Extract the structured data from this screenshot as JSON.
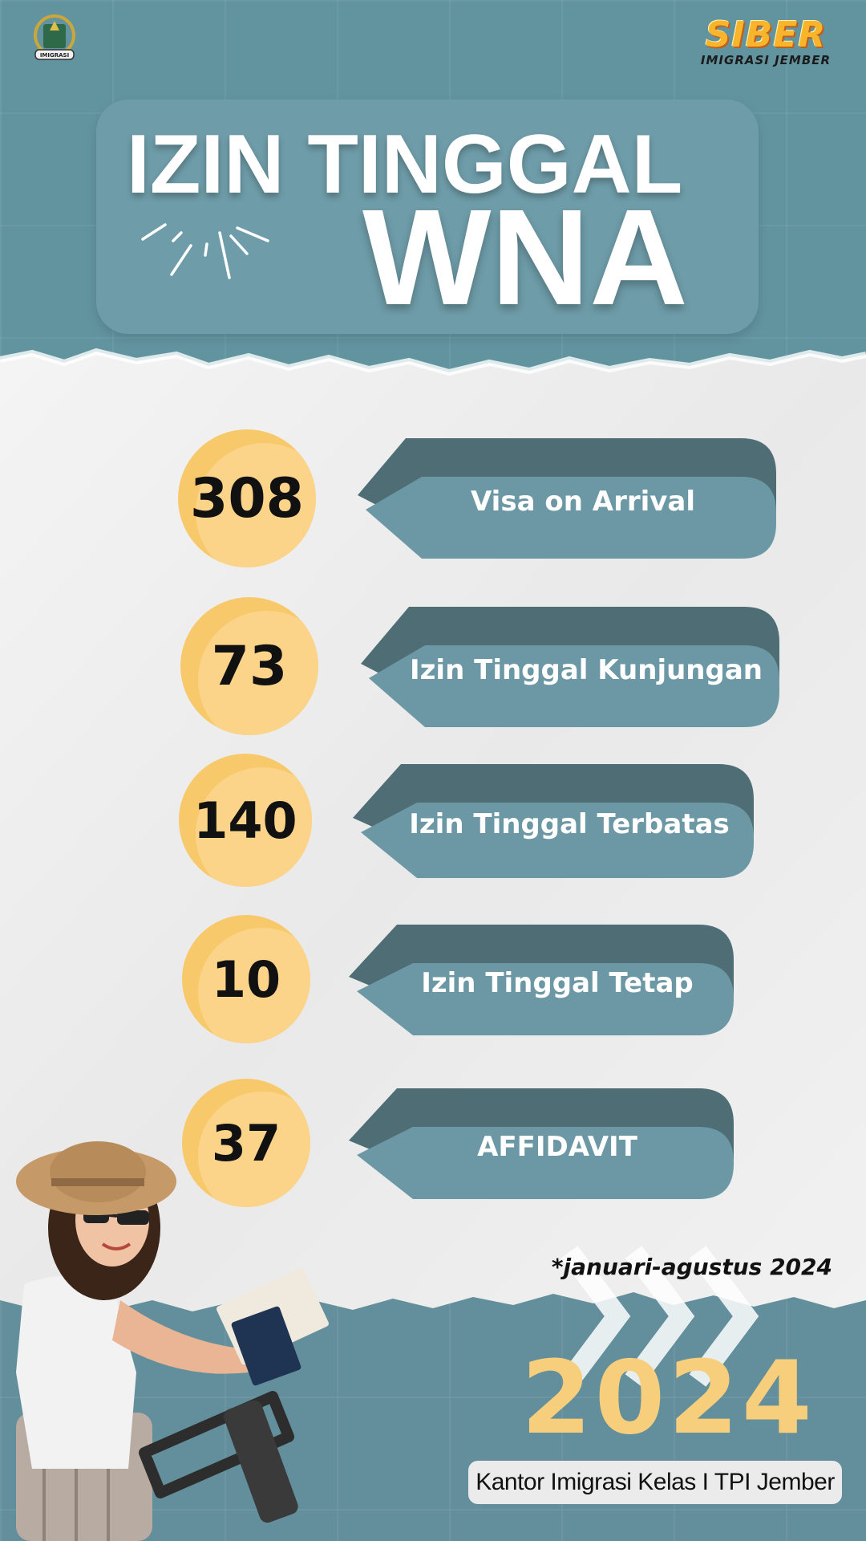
{
  "header": {
    "brand_name": "SIBER",
    "brand_sub": "IMIGRASI JEMBER",
    "logo_icon": "imigrasi-emblem-icon",
    "logo_text": "IMIGRASI"
  },
  "title": {
    "line1": "IZIN TINGGAL",
    "line2": "WNA"
  },
  "stats": [
    {
      "value": "308",
      "label": "Visa on Arrival"
    },
    {
      "value": "73",
      "label": "Izin Tinggal Kunjungan"
    },
    {
      "value": "140",
      "label": "Izin Tinggal Terbatas"
    },
    {
      "value": "10",
      "label": "Izin Tinggal Tetap"
    },
    {
      "value": "37",
      "label": "AFFIDAVIT"
    }
  ],
  "footer": {
    "period": "*januari-agustus 2024",
    "year": "2024",
    "office": "Kantor Imigrasi Kelas I TPI Jember"
  },
  "colors": {
    "teal_bg": "#628f9b",
    "tag_dark": "#4f6d75",
    "tag_light": "#6b98a4",
    "circle_yellow": "#f8c96b",
    "year_color": "#f6ce7c"
  }
}
